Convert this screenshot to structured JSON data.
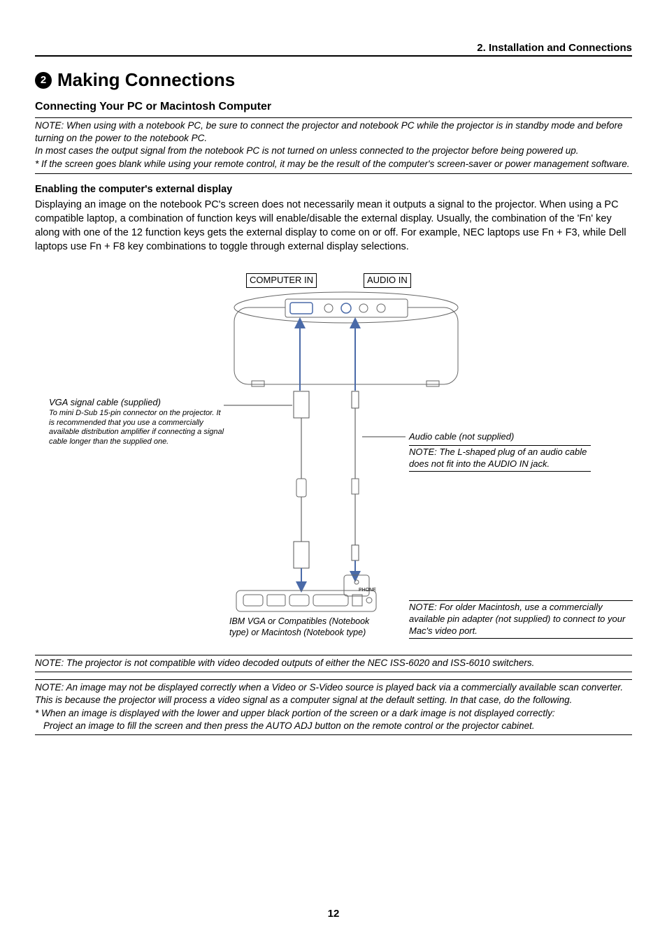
{
  "chapter": "2. Installation and Connections",
  "section_num": "2",
  "section_title": "Making Connections",
  "subsection": "Connecting Your PC or Macintosh Computer",
  "note1_l1": "NOTE: When using with a notebook PC, be sure to connect the projector and notebook PC while the projector is in standby mode and before turning on the power to the notebook PC.",
  "note1_l2": "In most cases the output signal from the notebook PC is not turned on unless connected to the projector before being powered up.",
  "note1_l3": "* If the screen goes blank while using your remote control, it may be the result of the computer's screen-saver or power management software.",
  "enable_hdr": "Enabling the computer's external display",
  "enable_body": "Displaying an image on the notebook PC's screen does not necessarily mean it outputs a signal to the projector. When using a PC compatible laptop, a combination of function keys will enable/disable the external display. Usually, the combination of the 'Fn' key along with one of the 12 function keys gets the external display to come on or off. For example, NEC laptops use Fn + F3, while Dell laptops use Fn + F8 key combinations to toggle through external display selections.",
  "lbl_computer_in": "COMPUTER IN",
  "lbl_audio_in": "AUDIO IN",
  "lbl_vga_head": "VGA signal cable (supplied)",
  "lbl_vga_body": "To mini D-Sub 15-pin connector on the projector. It is recommended that you use a commercially available distribution amplifier if connecting a signal cable longer than the supplied one.",
  "lbl_audio_cable": "Audio cable (not supplied)",
  "lbl_audio_note": "NOTE: The L-shaped plug of an audio cable does not fit into the AUDIO IN jack.",
  "lbl_phone": "PHONE",
  "lbl_ibm": "IBM VGA or Compatibles (Notebook type) or Macintosh (Notebook type)",
  "lbl_mac_note": "NOTE: For older Macintosh, use a commercially available pin adapter (not supplied) to connect to your Mac's video port.",
  "note2": "NOTE: The projector is not compatible with video decoded outputs of either the NEC ISS-6020 and ISS-6010 switchers.",
  "note3_l1": "NOTE: An image may not be displayed correctly when a Video or S-Video source is played back via a commercially available scan converter.",
  "note3_l2": "This is because the projector will process a video signal as a computer signal at the default setting. In that case, do the following.",
  "note3_l3": "* When an image is displayed with the lower and upper black portion of the screen or a dark image is not displayed correctly:",
  "note3_l4": "Project an image to fill the screen and then press the AUTO ADJ button on the remote control or the projector cabinet.",
  "page_number": "12"
}
